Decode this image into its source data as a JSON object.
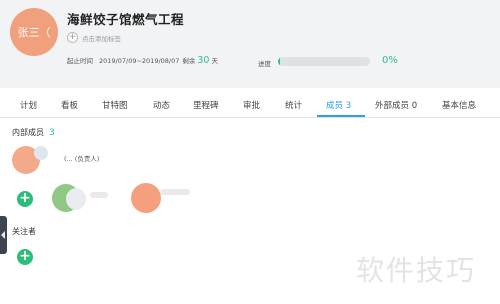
{
  "header": {
    "avatar_text": "张三（",
    "title": "海鲜饺子馆燃气工程",
    "add_tag": "点击添加标签",
    "time_label": "起止时间",
    "time_range": "2019/07/09~2019/08/07",
    "remaining_label": "剩余",
    "remaining_days": "30",
    "days_unit": "天",
    "progress_label": "进度",
    "progress_percent": "0%",
    "progress_value": 0.02,
    "accent": "#2dbd9b"
  },
  "tabs": [
    {
      "label": "计划"
    },
    {
      "label": "看板"
    },
    {
      "label": "甘特图"
    },
    {
      "label": "动态"
    },
    {
      "label": "里程碑"
    },
    {
      "label": "审批"
    },
    {
      "label": "统计"
    },
    {
      "label": "成员 3",
      "active": true
    },
    {
      "label": "外部成员 0"
    },
    {
      "label": "基本信息"
    }
  ],
  "members": {
    "internal_title": "内部成员",
    "internal_count": "3",
    "owner_suffix": "(... (负责人)",
    "followers_title": "关注者"
  },
  "watermark": "软件技巧",
  "colors": {
    "active_tab": "#2a9df4",
    "add_button": "#2dbd7a"
  }
}
